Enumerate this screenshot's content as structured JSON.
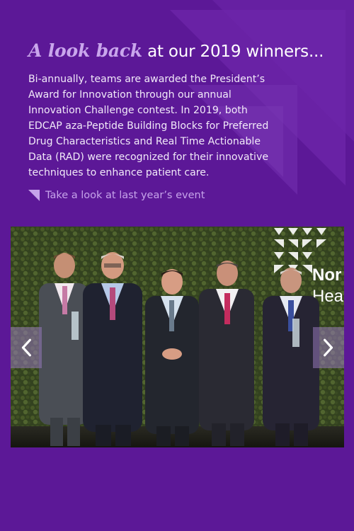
{
  "header": {
    "script_text": "A look back",
    "title_rest": " at our 2019 winners..."
  },
  "intro": {
    "text": "Bi-annually, teams are awarded the President’s Award for Innovation through our annual Innovation Challenge contest. In 2019, both EDCAP aza-Peptide Building Blocks for Preferred Drug Characteristics and Real Time Actionable Data (RAD) were recognized for their innovative techniques to enhance patient care."
  },
  "event_link": {
    "label": "Take a look at last year’s event",
    "icon": "corner-triangle-icon"
  },
  "carousel": {
    "photo_description_icon": "winners-group-photo",
    "backdrop_text_line1": "Nor",
    "backdrop_text_line2": "Hea",
    "prev_icon": "chevron-left-icon",
    "next_icon": "chevron-right-icon"
  },
  "colors": {
    "background": "#5c1897",
    "accent_light_purple": "#c6a3ea",
    "text_white": "#ffffff",
    "nav_button": "#9678b9"
  }
}
